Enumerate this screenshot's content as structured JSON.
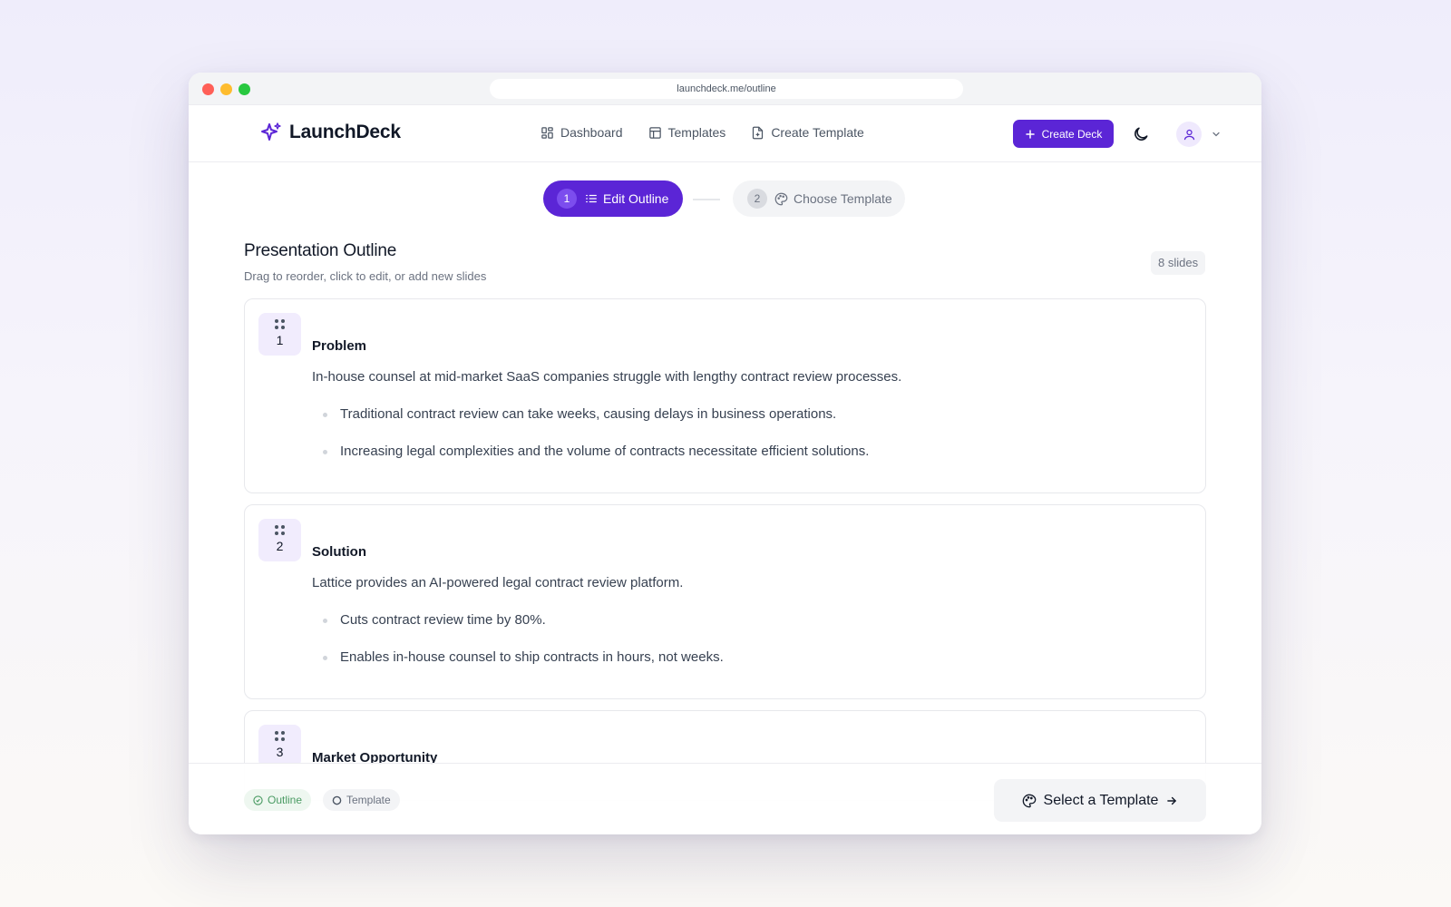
{
  "browser": {
    "url": "launchdeck.me/outline"
  },
  "nav": {
    "brand": "LaunchDeck",
    "links": [
      {
        "label": "Dashboard",
        "icon": "grid-icon"
      },
      {
        "label": "Templates",
        "icon": "layout-icon"
      },
      {
        "label": "Create Template",
        "icon": "file-plus-icon"
      }
    ],
    "create_button": "Create Deck",
    "accent_color": "#5b25d6"
  },
  "stepper": {
    "steps": [
      {
        "number": "1",
        "label": "Edit Outline",
        "active": true
      },
      {
        "number": "2",
        "label": "Choose Template",
        "active": false
      }
    ]
  },
  "outline": {
    "title": "Presentation Outline",
    "subtitle": "Drag to reorder, click to edit, or add new slides",
    "slide_count": "8 slides",
    "slides": [
      {
        "number": "1",
        "title": "Problem",
        "description": "In-house counsel at mid-market SaaS companies struggle with lengthy contract review processes.",
        "bullets": [
          "Traditional contract review can take weeks, causing delays in business operations.",
          "Increasing legal complexities and the volume of contracts necessitate efficient solutions."
        ]
      },
      {
        "number": "2",
        "title": "Solution",
        "description": "Lattice provides an AI-powered legal contract review platform.",
        "bullets": [
          "Cuts contract review time by 80%.",
          "Enables in-house counsel to ship contracts in hours, not weeks."
        ]
      },
      {
        "number": "3",
        "title": "Market Opportunity"
      }
    ]
  },
  "footer": {
    "progress": [
      {
        "label": "Outline",
        "status": "done"
      },
      {
        "label": "Template",
        "status": "pending"
      }
    ],
    "next_button": "Select a Template"
  }
}
